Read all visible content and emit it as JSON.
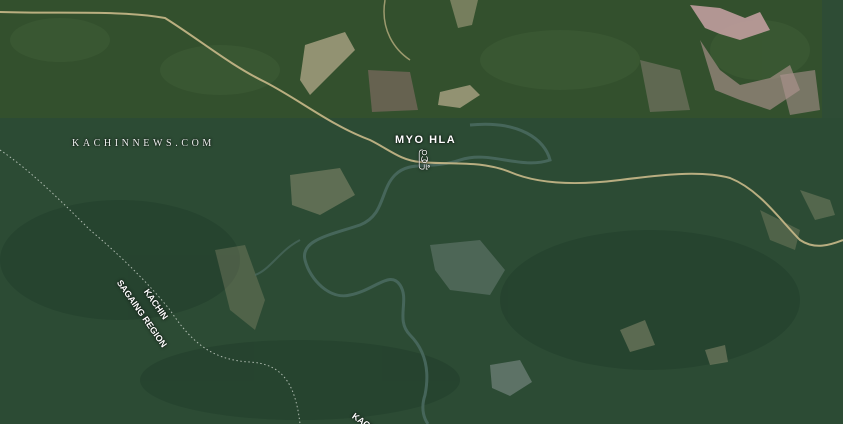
{
  "map": {
    "watermark": "KACHINNEWS.COM",
    "town_label": "MYO HLA",
    "town_label_local": "မြို့",
    "region_labels": {
      "kachin": "KACHIN",
      "sagaing": "SAGAING REGION",
      "kachin_bottom": "KACHI"
    },
    "colors": {
      "forest_dark": "#2b4a33",
      "forest_top": "#35502f",
      "clearing": "#9e9c7c",
      "mining_pink": "#c9a3a5",
      "road": "#c9b98a",
      "river": "#4b6b61",
      "border_dots": "#d9e0d8"
    }
  }
}
